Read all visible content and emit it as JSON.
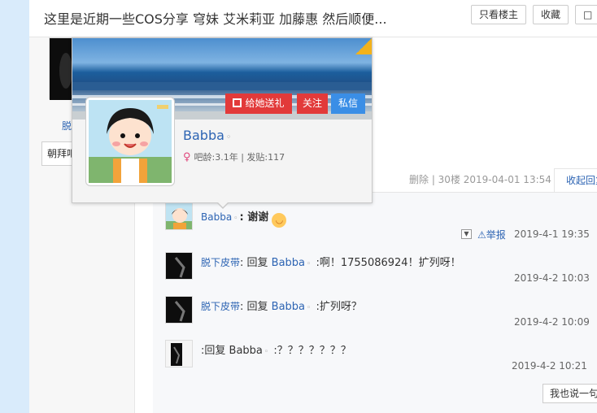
{
  "header": {
    "title": "这里是近期一些COS分享 穹妹 艾米莉亚 加藤惠 然后顺便...",
    "only_host_label": "只看楼主",
    "favorite_label": "收藏"
  },
  "left": {
    "author_name_partial": "脱",
    "button_label_partial": "朝拜吧"
  },
  "popup": {
    "gift_label": "给她送礼",
    "follow_label": "关注",
    "message_label": "私信",
    "name": "Babba",
    "stats": "吧龄:3.1年 | 发贴:117"
  },
  "post": {
    "meta": "删除 | 30楼  2019-04-01 13:54",
    "fold_label": "收起回复"
  },
  "comments": [
    {
      "user": "Babba",
      "text": ": 谢谢",
      "time": "2019-4-1 19:35",
      "report_label": "举报"
    },
    {
      "user": "脱下皮带",
      "reply_prefix": ": 回复",
      "reply_to": "Babba",
      "text": " :啊！1755086924！扩列呀！",
      "time": "2019-4-2 10:03"
    },
    {
      "user": "脱下皮带",
      "reply_prefix": ": 回复",
      "reply_to": "Babba",
      "text": " :扩列呀？",
      "time": "2019-4-2 10:09"
    },
    {
      "reply_prefix": ":回复",
      "reply_to": "Babba",
      "text": " :？？？？？？？",
      "time": "2019-4-2 10:21"
    }
  ],
  "say_label": "我也说一句",
  "colors": {
    "link": "#2d64b3",
    "gift_button": "#e23a3a",
    "follow_button": "#e23a3a",
    "message_button": "#3a8ee6",
    "gender_female": "#e0457b"
  }
}
